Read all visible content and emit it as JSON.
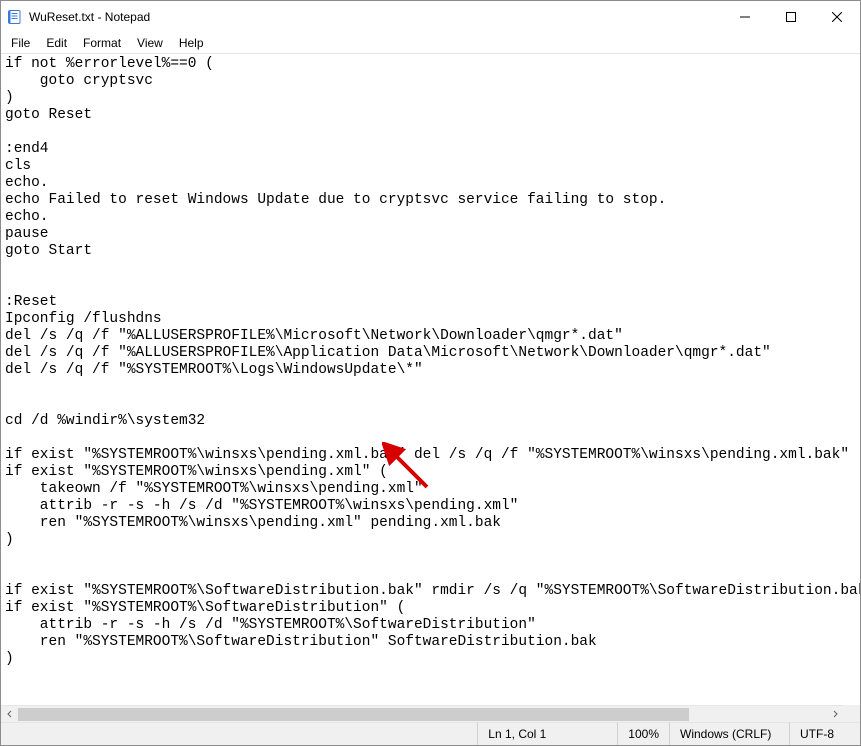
{
  "titlebar": {
    "icon_name": "notepad-icon",
    "title": "WuReset.txt - Notepad"
  },
  "menu": {
    "items": [
      "File",
      "Edit",
      "Format",
      "View",
      "Help"
    ]
  },
  "editor": {
    "content": "if not %errorlevel%==0 (\n    goto cryptsvc\n)\ngoto Reset\n\n:end4\ncls\necho.\necho Failed to reset Windows Update due to cryptsvc service failing to stop.\necho.\npause\ngoto Start\n\n\n:Reset\nIpconfig /flushdns\ndel /s /q /f \"%ALLUSERSPROFILE%\\Microsoft\\Network\\Downloader\\qmgr*.dat\"\ndel /s /q /f \"%ALLUSERSPROFILE%\\Application Data\\Microsoft\\Network\\Downloader\\qmgr*.dat\"\ndel /s /q /f \"%SYSTEMROOT%\\Logs\\WindowsUpdate\\*\"\n\n\ncd /d %windir%\\system32\n\nif exist \"%SYSTEMROOT%\\winsxs\\pending.xml.bak\" del /s /q /f \"%SYSTEMROOT%\\winsxs\\pending.xml.bak\"\nif exist \"%SYSTEMROOT%\\winsxs\\pending.xml\" (\n    takeown /f \"%SYSTEMROOT%\\winsxs\\pending.xml\"\n    attrib -r -s -h /s /d \"%SYSTEMROOT%\\winsxs\\pending.xml\"\n    ren \"%SYSTEMROOT%\\winsxs\\pending.xml\" pending.xml.bak\n)\n\n\nif exist \"%SYSTEMROOT%\\SoftwareDistribution.bak\" rmdir /s /q \"%SYSTEMROOT%\\SoftwareDistribution.bak\"\nif exist \"%SYSTEMROOT%\\SoftwareDistribution\" (\n    attrib -r -s -h /s /d \"%SYSTEMROOT%\\SoftwareDistribution\"\n    ren \"%SYSTEMROOT%\\SoftwareDistribution\" SoftwareDistribution.bak\n)\n"
  },
  "statusbar": {
    "position": "Ln 1, Col 1",
    "zoom": "100%",
    "line_ending": "Windows (CRLF)",
    "encoding": "UTF-8"
  },
  "annotation": {
    "color": "#d60000"
  }
}
